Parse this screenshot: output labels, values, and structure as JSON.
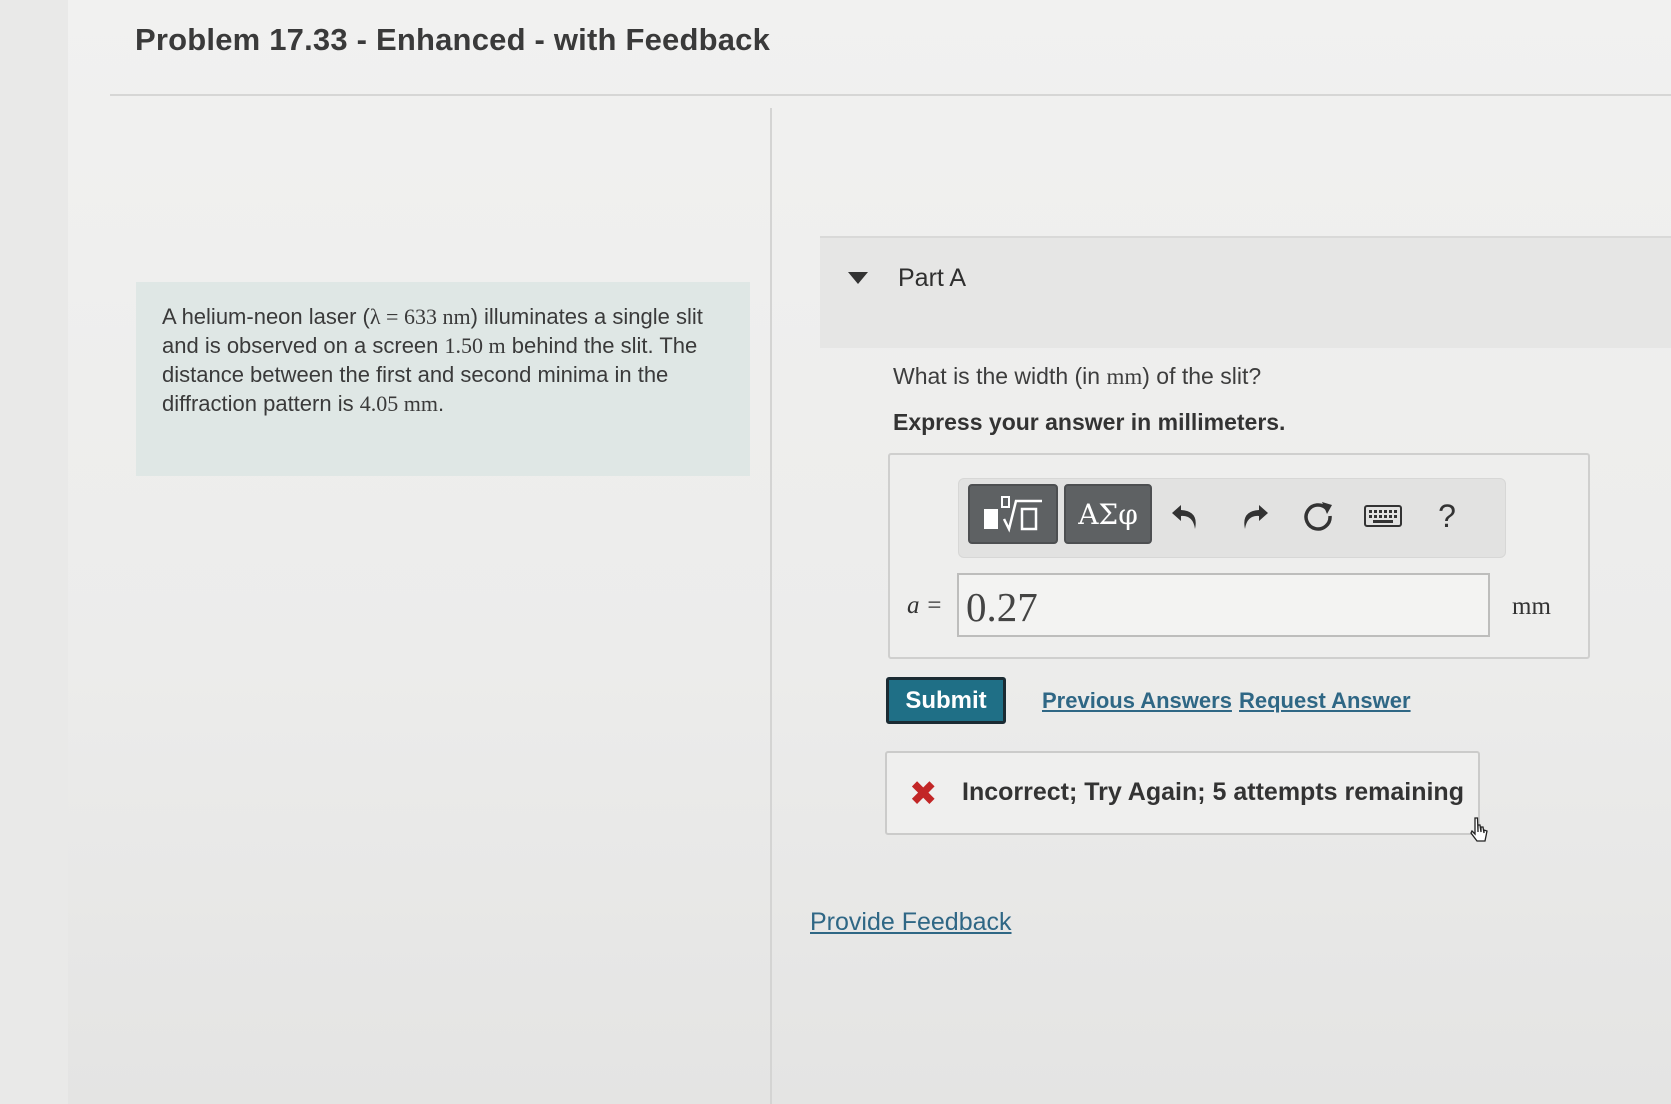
{
  "title": "Problem 17.33 - Enhanced - with Feedback",
  "intro": {
    "t1": "A helium-neon laser (",
    "m1": "λ = 633 nm",
    "t2": ") illuminates a single slit and is observed on a screen ",
    "m2": "1.50 m",
    "t3": " behind the slit. The distance between the first and second minima in the diffraction pattern is ",
    "m3": "4.05 mm",
    "t4": "."
  },
  "part": {
    "label": "Part A",
    "question_pre": "What is the width (in ",
    "question_unit": "mm",
    "question_post": ") of the slit?",
    "instruction": "Express your answer in millimeters."
  },
  "toolbar": {
    "templates_icon": "templates-sqrt-icon",
    "greek_label": "ΑΣφ",
    "undo_icon": "undo-icon",
    "redo_icon": "redo-icon",
    "reset_icon": "reset-icon",
    "keyboard_icon": "keyboard-icon",
    "help_label": "?"
  },
  "answer": {
    "variable": "a =",
    "value": "0.27",
    "unit": "mm"
  },
  "actions": {
    "submit": "Submit",
    "previous_answers": "Previous Answers",
    "request_answer": "Request Answer"
  },
  "feedback": {
    "icon": "x-icon",
    "message": "Incorrect; Try Again; 5 attempts remaining"
  },
  "provide_feedback": "Provide Feedback",
  "colors": {
    "submit": "#1f6f86",
    "link": "#2f6785",
    "error": "#c22626",
    "intro_bg": "#dfe7e5"
  }
}
